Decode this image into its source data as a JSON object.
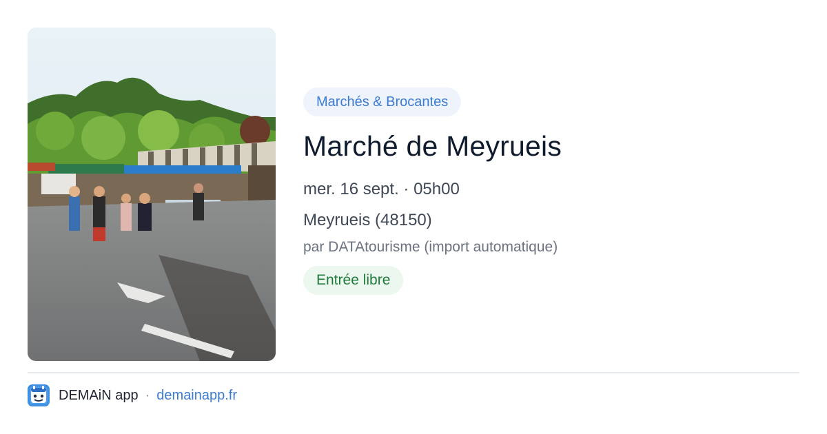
{
  "event": {
    "category": "Marchés & Brocantes",
    "title": "Marché de Meyrueis",
    "datetime": "mer. 16 sept. · 05h00",
    "location": "Meyrueis (48150)",
    "source": "par DATAtourisme (import automatique)",
    "price": "Entrée libre",
    "image_icon": "market-photo"
  },
  "footer": {
    "app_name": "DEMAiN app",
    "separator": "·",
    "link": "demainapp.fr",
    "logo_icon": "demain-logo-icon"
  },
  "colors": {
    "category_bg": "#eff4fc",
    "category_text": "#3b7bd0",
    "price_bg": "#ecf8ef",
    "price_text": "#1f7a3a",
    "title_text": "#0f1b2d",
    "link_text": "#3b7bd0",
    "logo_bg": "#3d8ee0"
  }
}
